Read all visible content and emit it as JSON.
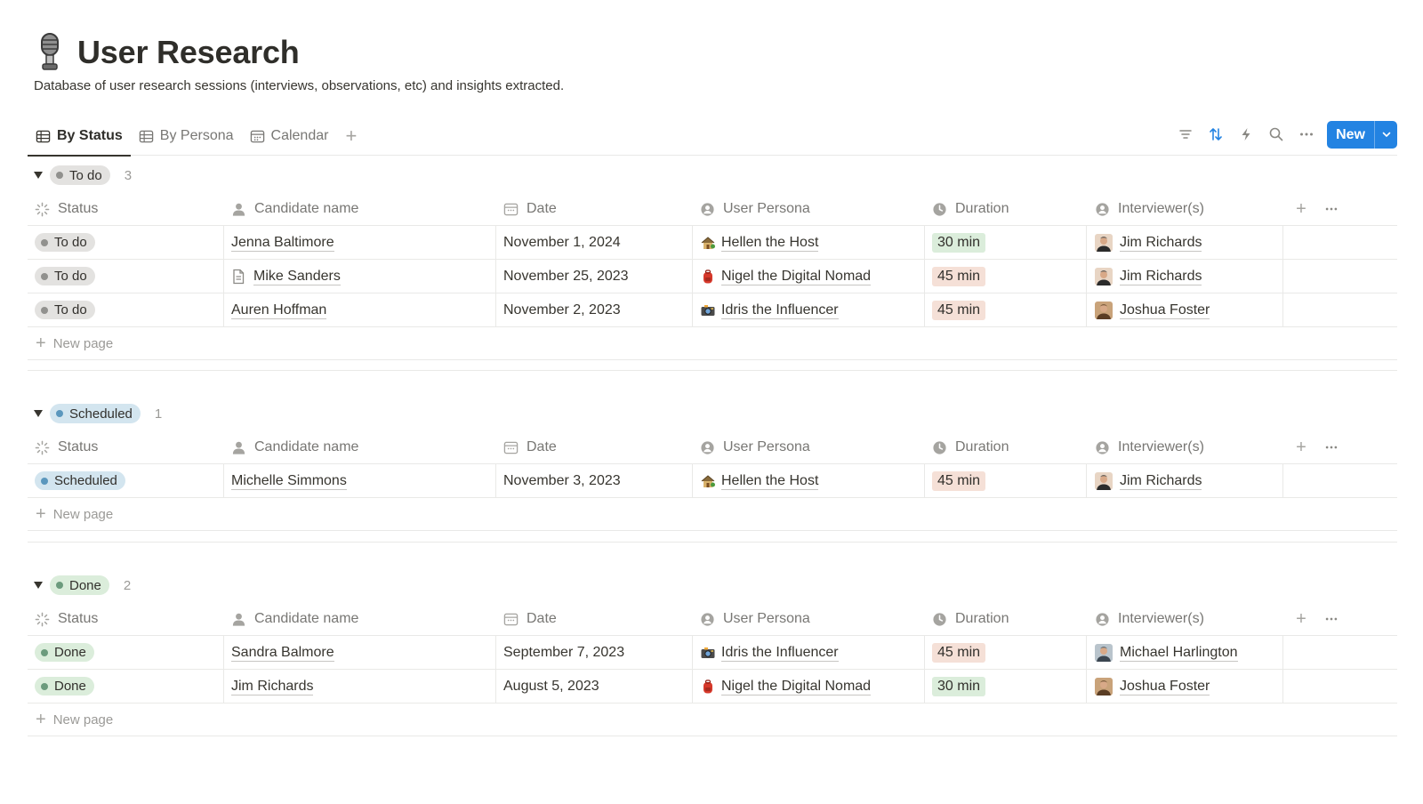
{
  "page": {
    "title": "User Research",
    "icon": "microphone-icon",
    "description": "Database of user research sessions (interviews, observations, etc) and insights extracted."
  },
  "views": [
    {
      "label": "By Status",
      "icon": "table-icon",
      "active": true
    },
    {
      "label": "By Persona",
      "icon": "table-icon",
      "active": false
    },
    {
      "label": "Calendar",
      "icon": "calendar-icon",
      "active": false
    }
  ],
  "toolbar": {
    "icons": [
      "filter-icon",
      "sort-icon",
      "lightning-icon",
      "search-icon",
      "more-icon"
    ],
    "new_label": "New",
    "accent": "#2383e2"
  },
  "columns": [
    "Status",
    "Candidate name",
    "Date",
    "User Persona",
    "Duration",
    "Interviewer(s)"
  ],
  "new_page_label": "New page",
  "groups": [
    {
      "name": "To do",
      "count": "3",
      "pill_bg": "#e3e2e0",
      "dot": "#91918e",
      "rows": [
        {
          "status": "To do",
          "candidate": "Jenna Baltimore",
          "doc": false,
          "date": "November 1, 2024",
          "persona": "Hellen the Host",
          "persona_icon": "house-icon",
          "duration": "30 min",
          "duration_bg": "#dbeddb",
          "interviewer": "Jim Richards"
        },
        {
          "status": "To do",
          "candidate": "Mike Sanders",
          "doc": true,
          "date": "November 25, 2023",
          "persona": "Nigel the Digital Nomad",
          "persona_icon": "backpack-icon",
          "duration": "45 min",
          "duration_bg": "#f5e0d7",
          "interviewer": "Jim Richards"
        },
        {
          "status": "To do",
          "candidate": "Auren Hoffman",
          "doc": false,
          "date": "November 2, 2023",
          "persona": "Idris the Influencer",
          "persona_icon": "camera-icon",
          "duration": "45 min",
          "duration_bg": "#f5e0d7",
          "interviewer": "Joshua Foster"
        }
      ]
    },
    {
      "name": "Scheduled",
      "count": "1",
      "pill_bg": "#d3e5ef",
      "dot": "#5b97bd",
      "rows": [
        {
          "status": "Scheduled",
          "candidate": "Michelle Simmons",
          "doc": false,
          "date": "November 3, 2023",
          "persona": "Hellen the Host",
          "persona_icon": "house-icon",
          "duration": "45 min",
          "duration_bg": "#f5e0d7",
          "interviewer": "Jim Richards"
        }
      ]
    },
    {
      "name": "Done",
      "count": "2",
      "pill_bg": "#dbeddb",
      "dot": "#6c9b7d",
      "rows": [
        {
          "status": "Done",
          "candidate": "Sandra Balmore",
          "doc": false,
          "date": "September 7, 2023",
          "persona": "Idris the Influencer",
          "persona_icon": "camera-icon",
          "duration": "45 min",
          "duration_bg": "#f5e0d7",
          "interviewer": "Michael Harlington"
        },
        {
          "status": "Done",
          "candidate": "Jim Richards",
          "doc": false,
          "date": "August 5, 2023",
          "persona": "Nigel the Digital Nomad",
          "persona_icon": "backpack-icon",
          "duration": "30 min",
          "duration_bg": "#dbeddb",
          "interviewer": "Joshua Foster"
        }
      ]
    }
  ]
}
